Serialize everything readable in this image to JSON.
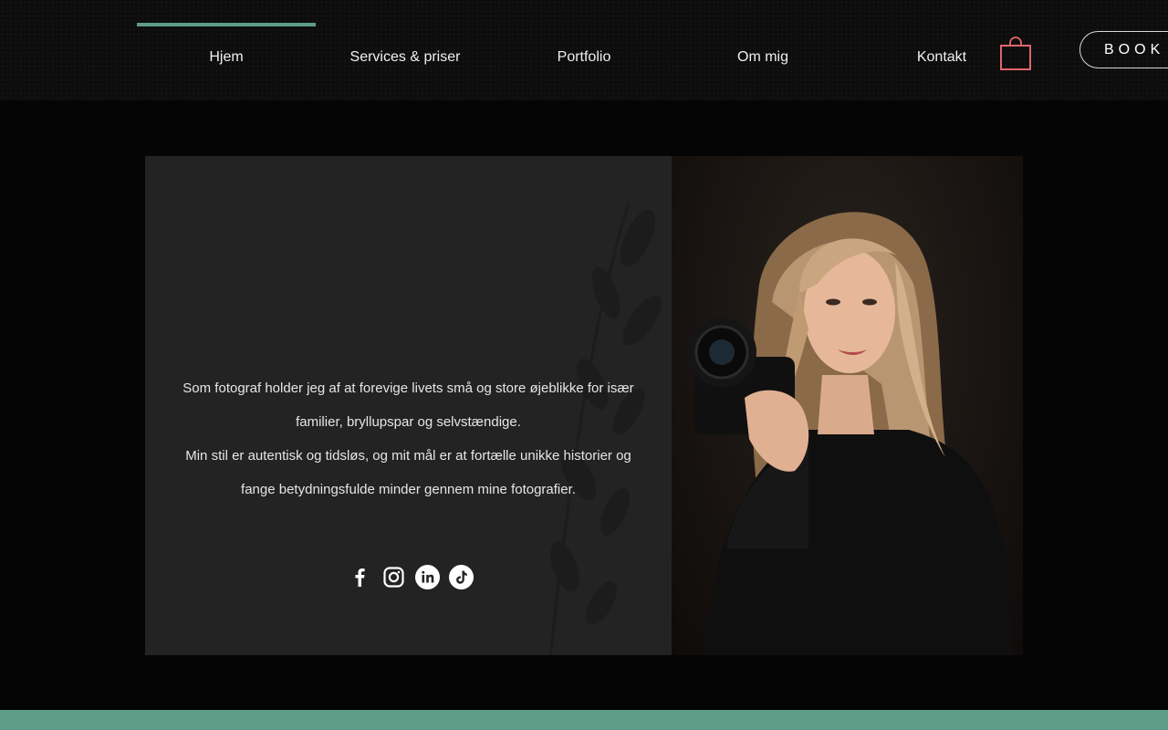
{
  "nav": {
    "items": [
      {
        "label": "Hjem",
        "active": true
      },
      {
        "label": "Services & priser",
        "active": false
      },
      {
        "label": "Portfolio",
        "active": false
      },
      {
        "label": "Om mig",
        "active": false
      },
      {
        "label": "Kontakt",
        "active": false
      }
    ],
    "cart_icon": "shopping-bag-icon",
    "book_label": "BOOK NU"
  },
  "hero": {
    "bio_line_1": "Som fotograf holder jeg af at forevige livets små og store øjeblikke for især familier, bryllupspar og selvstændige.",
    "bio_line_2": "Min stil er autentisk og tidsløs, og mit mål er at fortælle unikke historier og fange betydningsfulde minder gennem mine fotografier.",
    "socials": [
      "facebook-icon",
      "instagram-icon",
      "linkedin-icon",
      "tiktok-icon"
    ]
  },
  "colors": {
    "accent": "#5e9c88",
    "cart": "#e0656a",
    "background": "#050505",
    "card": "#232323"
  }
}
